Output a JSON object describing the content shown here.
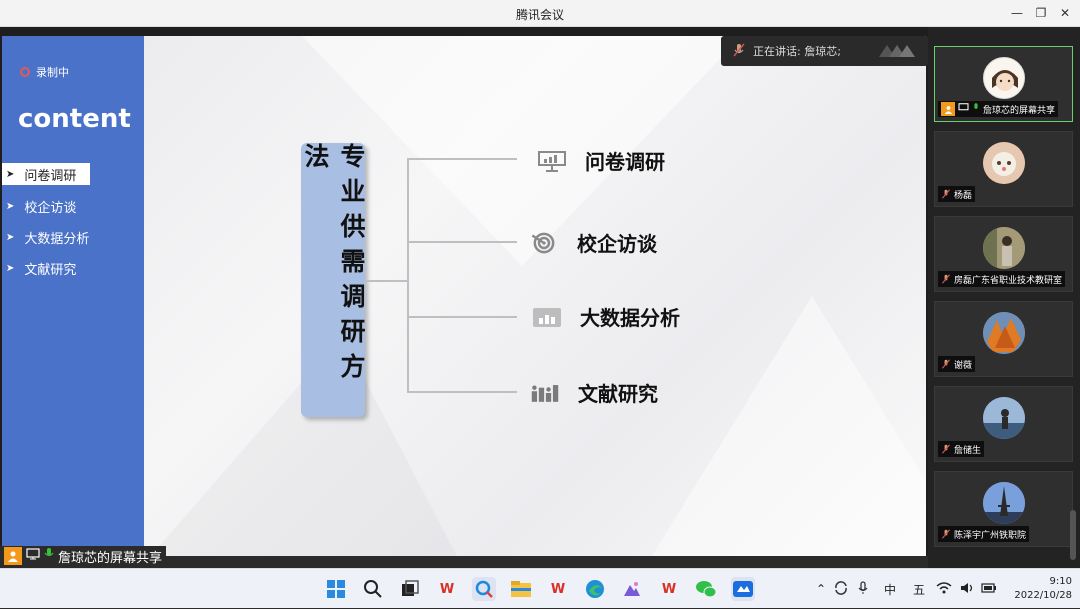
{
  "window": {
    "title": "腾讯会议"
  },
  "recording": {
    "label": "录制中"
  },
  "slide": {
    "heading": "content",
    "nav": [
      {
        "label": "问卷调研",
        "active": true
      },
      {
        "label": "校企访谈",
        "active": false
      },
      {
        "label": "大数据分析",
        "active": false
      },
      {
        "label": "文献研究",
        "active": false
      }
    ],
    "center_title": "专业供需调研方法",
    "branches": [
      {
        "label": "问卷调研",
        "icon": "presentation-board-icon"
      },
      {
        "label": "校企访谈",
        "icon": "target-icon"
      },
      {
        "label": "大数据分析",
        "icon": "bar-chart-icon"
      },
      {
        "label": "文献研究",
        "icon": "bar-chart-people-icon"
      }
    ]
  },
  "speaking": {
    "label": "正在讲话: 詹琼芯;"
  },
  "screen_share": {
    "label": "詹琼芯的屏幕共享"
  },
  "participants": [
    {
      "name": "詹琼芯的屏幕共享",
      "active": true,
      "avatar_color": "#f2e6dc"
    },
    {
      "name": "杨磊",
      "active": false,
      "avatar_color": "#d8b59a"
    },
    {
      "name": "房磊广东省职业技术教研室",
      "active": false,
      "avatar_color": "#8a8a6a"
    },
    {
      "name": "谢薇",
      "active": false,
      "avatar_color": "#d8742a"
    },
    {
      "name": "詹储生",
      "active": false,
      "avatar_color": "#5a7aa0"
    },
    {
      "name": "陈泽宇广州铁职院",
      "active": false,
      "avatar_color": "#6f8fc8"
    }
  ],
  "taskbar": {
    "ime1": "中",
    "ime2": "五",
    "time": "9:10",
    "date": "2022/10/28"
  },
  "colors": {
    "sidebar": "#4a72c8",
    "title_box": "#a9bee3",
    "active_tile_border": "#6ad06a",
    "orange": "#f39a1c"
  }
}
